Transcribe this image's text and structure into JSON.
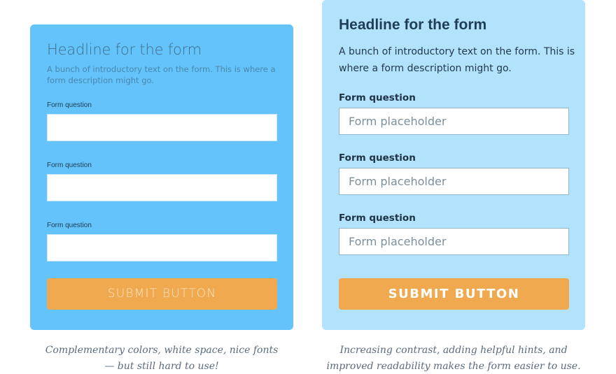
{
  "left_form": {
    "headline": "Headline for the form",
    "intro": "A bunch of introductory text on the form. This is where a form description might go.",
    "questions": [
      {
        "label": "Form question",
        "value": ""
      },
      {
        "label": "Form question",
        "value": ""
      },
      {
        "label": "Form question",
        "value": ""
      }
    ],
    "submit_label": "SUBMIT BUTTON",
    "colors": {
      "background": "#64c3fa",
      "button": "#f0a94f"
    }
  },
  "right_form": {
    "headline": "Headline for the form",
    "intro": "A bunch of introductory text on the form. This is where a form description might go.",
    "questions": [
      {
        "label": "Form question",
        "placeholder": "Form placeholder",
        "value": ""
      },
      {
        "label": "Form question",
        "placeholder": "Form placeholder",
        "value": ""
      },
      {
        "label": "Form question",
        "placeholder": "Form placeholder",
        "value": ""
      }
    ],
    "submit_label": "SUBMIT BUTTON",
    "colors": {
      "background": "#b2e2fc",
      "button": "#f0a94f"
    }
  },
  "captions": {
    "left": {
      "line1": "Complementary colors, white space, nice fonts",
      "line2": "— but still hard to use!"
    },
    "right": {
      "line1": "Increasing contrast, adding helpful hints, and",
      "line2": "improved readability makes the form easier to use."
    }
  }
}
